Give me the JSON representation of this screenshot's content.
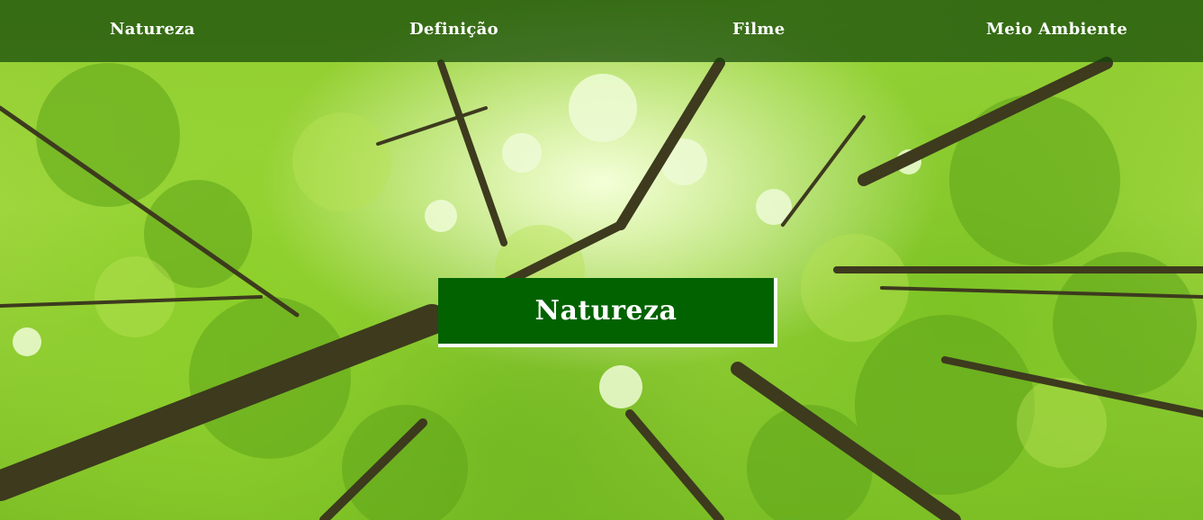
{
  "nav": {
    "items": [
      {
        "label": "Natureza"
      },
      {
        "label": "Definição"
      },
      {
        "label": "Filme"
      },
      {
        "label": "Meio Ambiente"
      }
    ]
  },
  "hero": {
    "title": "Natureza",
    "image": "forest-canopy-image"
  },
  "colors": {
    "navbar": "#1a4a0e",
    "title_box": "#026200",
    "text": "#ffffff"
  }
}
